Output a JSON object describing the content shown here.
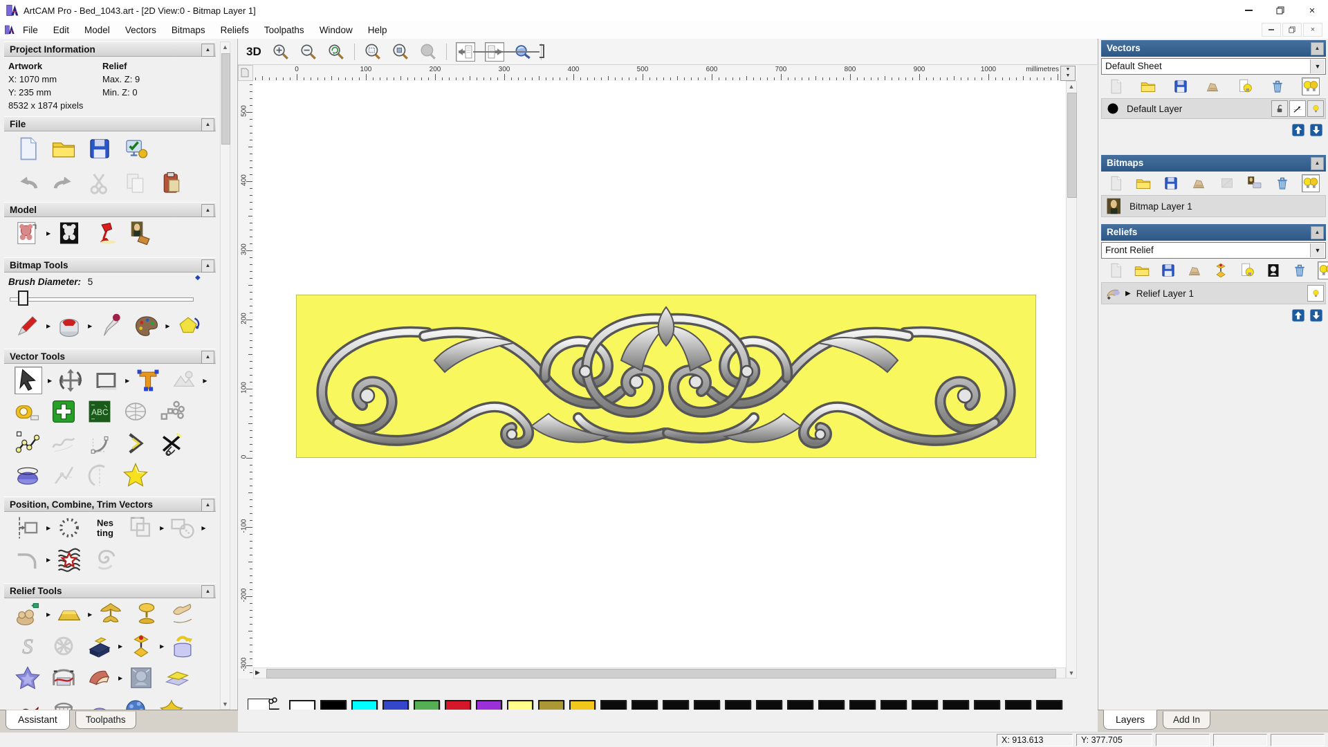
{
  "window": {
    "title": "ArtCAM Pro - Bed_1043.art - [2D View:0 - Bitmap Layer 1]",
    "controls": [
      "minimize",
      "restore",
      "close"
    ]
  },
  "menu": {
    "items": [
      "File",
      "Edit",
      "Model",
      "Vectors",
      "Bitmaps",
      "Reliefs",
      "Toolpaths",
      "Window",
      "Help"
    ],
    "mdi_controls": [
      "minimize",
      "restore",
      "close"
    ]
  },
  "assistant": {
    "project_information": {
      "title": "Project Information",
      "artwork_label": "Artwork",
      "relief_label": "Relief",
      "artwork_x": "X: 1070 mm",
      "artwork_y": "Y: 235 mm",
      "artwork_pixels": "8532 x 1874 pixels",
      "relief_max_z": "Max. Z: 9",
      "relief_min_z": "Min. Z: 0"
    },
    "file_section": "File",
    "model_section": "Model",
    "bitmap_tools_section": "Bitmap Tools",
    "vector_tools_section": "Vector Tools",
    "position_section": "Position, Combine, Trim Vectors",
    "relief_tools_section": "Relief Tools",
    "brush_diameter_label": "Brush Diameter:",
    "brush_diameter_value": "5",
    "tabs": [
      {
        "label": "Assistant",
        "active": true
      },
      {
        "label": "Toolpaths",
        "active": false
      }
    ]
  },
  "icons": {
    "file_row1": [
      "new-file",
      "open-folder",
      "save",
      "options"
    ],
    "file_row2": [
      "undo",
      "redo",
      "cut-gray",
      "copy-gray",
      "paste"
    ],
    "model_row": [
      "model-sketch",
      "|",
      "model-bw",
      "lamp",
      "monalisa"
    ],
    "bitmap_row": [
      "paint-brush",
      "|",
      "paint-bucket",
      "|",
      "color-picker",
      "palette-tool",
      "|",
      "flood-fill"
    ],
    "vector_row1": [
      "select-cursor!",
      "|",
      "transform",
      "create-rectangle",
      "|",
      "create-text",
      "mirror-gray",
      "|"
    ],
    "vector_row2": [
      "measure",
      "node-editing",
      "text-abc",
      "distort-gray",
      "block-copy-gray"
    ],
    "vector_row3": [
      "create-polyline",
      "free-sketch-gray",
      "create-arc",
      "offset-vector",
      "trim-vectors"
    ],
    "vector_row4": [
      "extrude-dome",
      "bisector-gray",
      "arc-fit-gray",
      "create-star"
    ],
    "position_row1": [
      "align-objects",
      "|",
      "text-on-curve",
      "nesting",
      "group-gray",
      "|",
      "weld-gray",
      "|"
    ],
    "position_row2": [
      "fillet-gray",
      "|",
      "texture-flow",
      "spiral-gray"
    ],
    "relief_row1": [
      "relief-clay",
      "|",
      "gold-bar",
      "|",
      "shape-fountain",
      "shape-mushroom",
      "extrude-hands"
    ],
    "relief_row2": [
      "sculpt-s-gray",
      "weave-gray",
      "emboss-book",
      "|",
      "relief-stamp",
      "|",
      "wrap-relief"
    ],
    "relief_row3": [
      "star-relief",
      "bridge-relief",
      "turn-relief",
      "|",
      "face-wizard",
      "offset-relief"
    ],
    "relief_row4": [
      "red-relief",
      "basket-weave",
      "dome-relief",
      "texture-sphere",
      "wing-relief"
    ],
    "view_toolbar": [
      "zoom-in",
      "zoom-out",
      "zoom-last",
      "sep",
      "zoom-box",
      "zoom-object",
      "zoom-gray",
      "sep",
      "prev-view!",
      "next-view!",
      "mag-blue",
      "sep"
    ],
    "vectors_toolbar": [
      "new-file-gray",
      "open-folder",
      "save",
      "merge-layers",
      "bulb-page",
      "trash",
      "bulbs-all!"
    ],
    "bitmaps_toolbar": [
      "new-file-gray",
      "open-folder",
      "save",
      "merge-layers",
      "gray-square",
      "bitmap-new",
      "trash",
      "bulbs-all!"
    ],
    "reliefs_toolbar": [
      "new-file-gray",
      "open-folder",
      "save",
      "merge-layers",
      "relief-stamp",
      "bulb-page",
      "emboss-bw",
      "trash",
      "bulbs-all!"
    ]
  },
  "view_toolbar": {
    "view_3d_label": "3D"
  },
  "ruler": {
    "units": "millimetres",
    "h_labels": [
      0,
      100,
      200,
      300,
      400,
      500,
      600,
      700,
      800,
      900,
      1000
    ],
    "v_labels": [
      500,
      400,
      300,
      200,
      100,
      0,
      -100,
      -200,
      -300
    ]
  },
  "artwork": {
    "width_mm": 1070,
    "height_mm": 235,
    "background_color": "#f8f75e",
    "relief_light": "#f0f0f0",
    "relief_mid": "#b9b9b9",
    "relief_dark": "#6c6c6c"
  },
  "layers_panel": {
    "vectors": {
      "title": "Vectors",
      "sheet_selector": "Default Sheet",
      "layer_name": "Default Layer"
    },
    "bitmaps": {
      "title": "Bitmaps",
      "layer_name": "Bitmap Layer 1"
    },
    "reliefs": {
      "title": "Reliefs",
      "relief_selector": "Front Relief",
      "layer_name": "Relief Layer 1"
    },
    "tabs": [
      {
        "label": "Layers",
        "active": true
      },
      {
        "label": "Add In",
        "active": false
      }
    ]
  },
  "palette": {
    "primary": "#ffffff",
    "secondary": "#000000",
    "swatches": [
      "#ffffff",
      "#000000",
      "#00ffff",
      "#3447cc",
      "#55b055",
      "#d4182a",
      "#9b30d9",
      "#ffff8c",
      "#ab9733",
      "#f2c71c",
      "#0b0b0b",
      "#0b0b0b",
      "#0b0b0b",
      "#0b0b0b",
      "#0b0b0b",
      "#0b0b0b",
      "#0b0b0b",
      "#0b0b0b",
      "#0b0b0b",
      "#0b0b0b",
      "#0b0b0b",
      "#0b0b0b",
      "#0b0b0b",
      "#0b0b0b",
      "#0b0b0b"
    ]
  },
  "status_bar": {
    "x_coordinate": "X: 913.613",
    "y_coordinate": "Y: 377.705",
    "empty_cells": 3
  }
}
